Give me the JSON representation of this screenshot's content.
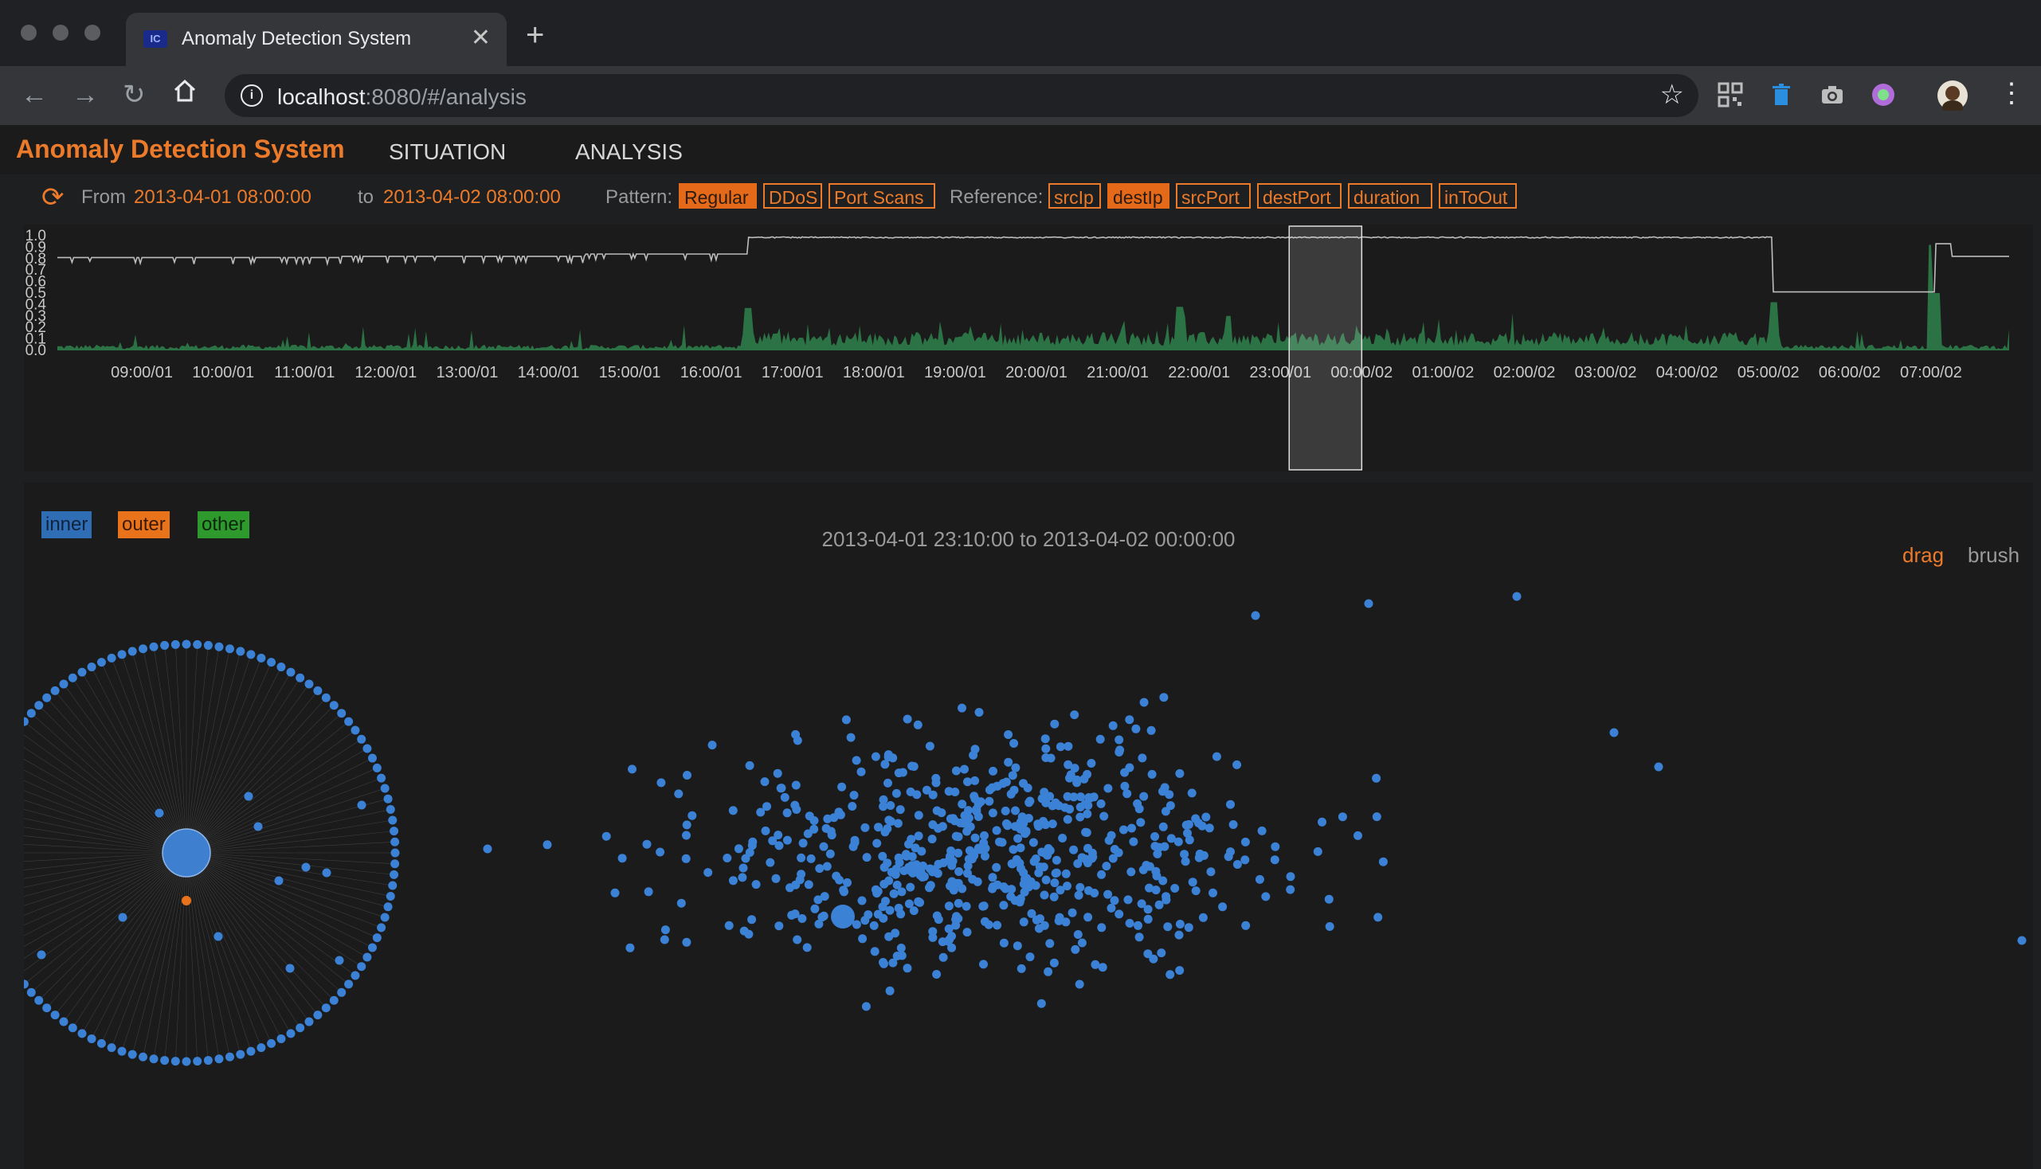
{
  "browser": {
    "tab_title": "Anomaly Detection System",
    "url_host": "localhost",
    "url_rest": ":8080/#/analysis",
    "new_tab": "+",
    "close": "✕"
  },
  "app": {
    "title": "Anomaly Detection System",
    "nav": [
      "SITUATION",
      "ANALYSIS"
    ]
  },
  "filters": {
    "from_label": "From",
    "from_value": "2013-04-01 08:00:00",
    "to_label": "to",
    "to_value": "2013-04-02 08:00:00",
    "pattern_label": "Pattern:",
    "patterns": [
      {
        "label": "Regular",
        "active": true
      },
      {
        "label": "DDoS",
        "active": false
      },
      {
        "label": "Port Scans",
        "active": false
      }
    ],
    "reference_label": "Reference:",
    "references": [
      {
        "label": "srcIp",
        "active": false
      },
      {
        "label": "destIp",
        "active": true
      },
      {
        "label": "srcPort",
        "active": false
      },
      {
        "label": "destPort",
        "active": false
      },
      {
        "label": "duration",
        "active": false
      },
      {
        "label": "inToOut",
        "active": false
      }
    ]
  },
  "timeline": {
    "y_ticks": [
      "1.0",
      "0.9",
      "0.8",
      "0.7",
      "0.6",
      "0.5",
      "0.4",
      "0.3",
      "0.2",
      "0.1",
      "0.0"
    ],
    "x_ticks": [
      "09:00/01",
      "10:00/01",
      "11:00/01",
      "12:00/01",
      "13:00/01",
      "14:00/01",
      "15:00/01",
      "16:00/01",
      "17:00/01",
      "18:00/01",
      "19:00/01",
      "20:00/01",
      "21:00/01",
      "22:00/01",
      "23:00/01",
      "00:00/02",
      "01:00/02",
      "02:00/02",
      "03:00/02",
      "04:00/02",
      "05:00/02",
      "06:00/02",
      "07:00/02"
    ],
    "line_color": "#bdbdbd",
    "area_color": "#2e7d4a",
    "line_levels": [
      {
        "from_hour": 0,
        "to_hour": 3.5,
        "value": 0.81
      },
      {
        "from_hour": 3.5,
        "to_hour": 6.5,
        "value": 0.82
      },
      {
        "from_hour": 6.5,
        "to_hour": 8.5,
        "value": 0.84
      },
      {
        "from_hour": 8.5,
        "to_hour": 21.1,
        "value": 0.99
      },
      {
        "from_hour": 21.1,
        "to_hour": 23.1,
        "value": 0.51
      },
      {
        "from_hour": 23.1,
        "to_hour": 23.3,
        "value": 0.93
      },
      {
        "from_hour": 23.3,
        "to_hour": 24,
        "value": 0.82
      }
    ],
    "brush_range": [
      "23:10",
      "00:00"
    ]
  },
  "scatter": {
    "legend": [
      {
        "label": "inner",
        "color": "#2f6db5"
      },
      {
        "label": "outer",
        "color": "#e9731b"
      },
      {
        "label": "other",
        "color": "#2e9a2e"
      }
    ],
    "range_label": "2013-04-01 23:10:00 to 2013-04-02 00:00:00",
    "modes": {
      "drag": "drag",
      "brush": "brush"
    },
    "node_color": "#3b82d6",
    "link_color": "#5a5a5a"
  }
}
